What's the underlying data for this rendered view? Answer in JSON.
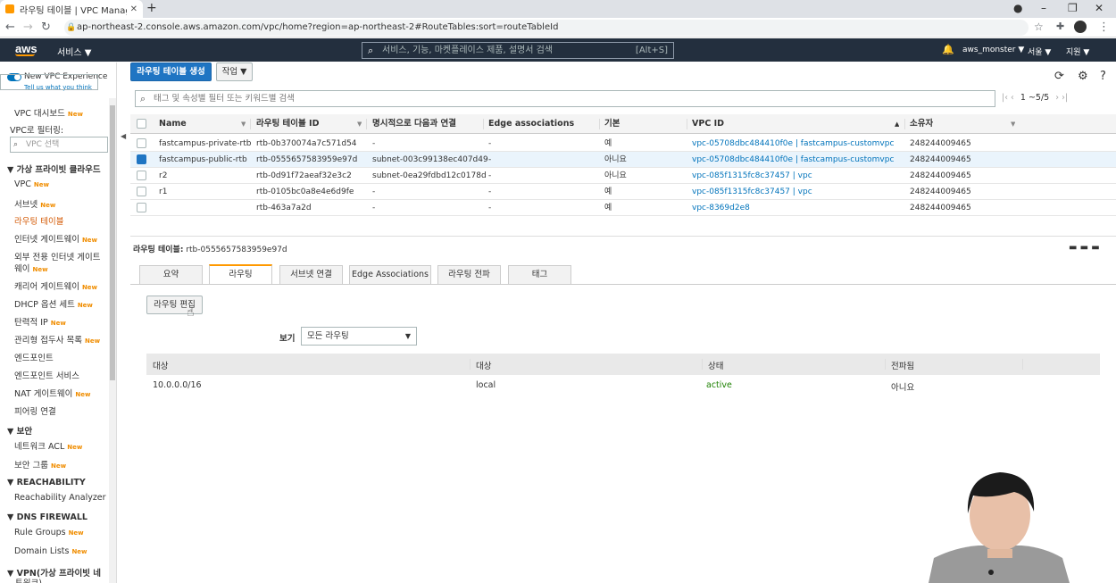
{
  "browser": {
    "tab_title": "라우팅 테이블 | VPC Manag",
    "url": "ap-northeast-2.console.aws.amazon.com/vpc/home?region=ap-northeast-2#RouteTables:sort=routeTableId"
  },
  "header": {
    "logo": "aws",
    "services": "서비스 ▼",
    "search_placeholder": "서비스, 기능, 마켓플레이스 제품, 설명서 검색",
    "search_shortcut": "[Alt+S]",
    "account": "aws_monster ▼",
    "region": "서울 ▼",
    "support": "지원 ▼"
  },
  "sidebar": {
    "new_experience": "New VPC Experience",
    "tell_us": "Tell us what you think",
    "dashboard": "VPC 대시보드",
    "filter_label": "VPC로 필터링:",
    "filter_placeholder": "VPC 선택",
    "section_vpc": "▼ 가상 프라이빗 클라우드",
    "items": [
      {
        "label": "VPC",
        "new": "New"
      },
      {
        "label": "서브넷",
        "new": "New"
      },
      {
        "label": "라우팅 테이블",
        "new": ""
      },
      {
        "label": "인터넷 게이트웨이",
        "new": "New"
      },
      {
        "label": "외부 전용 인터넷 게이트",
        "new": ""
      },
      {
        "label": "웨이",
        "new": "New"
      },
      {
        "label": "캐리어 게이트웨이",
        "new": "New"
      },
      {
        "label": "DHCP 옵션 세트",
        "new": "New"
      },
      {
        "label": "탄력적 IP",
        "new": "New"
      },
      {
        "label": "관리형 접두사 목록",
        "new": "New"
      },
      {
        "label": "엔드포인트",
        "new": ""
      },
      {
        "label": "엔드포인트 서비스",
        "new": ""
      },
      {
        "label": "NAT 게이트웨이",
        "new": "New"
      },
      {
        "label": "피어링 연결",
        "new": ""
      }
    ],
    "section_security": "▼ 보안",
    "security_items": [
      {
        "label": "네트워크 ACL",
        "new": "New"
      },
      {
        "label": "보안 그룹",
        "new": "New"
      }
    ],
    "section_reach": "▼ REACHABILITY",
    "reach_item": "Reachability Analyzer",
    "section_dns": "▼ DNS FIREWALL",
    "dns_items": [
      {
        "label": "Rule Groups",
        "new": "New"
      },
      {
        "label": "Domain Lists",
        "new": "New"
      }
    ],
    "section_vpn": "▼ VPN(가상 프라이빗 네",
    "section_vpn2": "트워크)",
    "new_badge": "New"
  },
  "toolbar": {
    "create": "라우팅 테이블 생성",
    "actions": "작업 ▼"
  },
  "filter": {
    "placeholder": "태그 및 속성별 필터 또는 키워드별 검색",
    "pager": "1 ~5/5"
  },
  "table": {
    "headers": [
      "Name",
      "라우팅 테이블 ID",
      "명시적으로 다음과 연결",
      "Edge associations",
      "기본",
      "VPC ID",
      "소유자"
    ],
    "rows": [
      {
        "name": "fastcampus-private-rtb",
        "id": "rtb-0b370074a7c571d54",
        "assoc": "-",
        "edge": "-",
        "main": "예",
        "vpc": "vpc-05708dbc484410f0e | fastcampus-customvpc",
        "owner": "248244009465"
      },
      {
        "name": "fastcampus-public-rtb",
        "id": "rtb-0555657583959e97d",
        "assoc": "subnet-003c99138ec407d49",
        "edge": "-",
        "main": "아니요",
        "vpc": "vpc-05708dbc484410f0e | fastcampus-customvpc",
        "owner": "248244009465"
      },
      {
        "name": "r2",
        "id": "rtb-0d91f72aeaf32e3c2",
        "assoc": "subnet-0ea29fdbd12c0178d",
        "edge": "-",
        "main": "아니요",
        "vpc": "vpc-085f1315fc8c37457 | vpc",
        "owner": "248244009465"
      },
      {
        "name": "r1",
        "id": "rtb-0105bc0a8e4e6d9fe",
        "assoc": "-",
        "edge": "-",
        "main": "예",
        "vpc": "vpc-085f1315fc8c37457 | vpc",
        "owner": "248244009465"
      },
      {
        "name": "",
        "id": "rtb-463a7a2d",
        "assoc": "-",
        "edge": "-",
        "main": "예",
        "vpc": "vpc-8369d2e8",
        "owner": "248244009465"
      }
    ]
  },
  "detail": {
    "label": "라우팅 테이블:",
    "id": "rtb-0555657583959e97d",
    "tabs": [
      "요약",
      "라우팅",
      "서브넷 연결",
      "Edge Associations",
      "라우팅 전파",
      "태그"
    ],
    "edit_button": "라우팅 편집",
    "view_label": "보기",
    "view_value": "모든 라우팅",
    "route_headers": [
      "대상",
      "대상",
      "상태",
      "전파됨"
    ],
    "routes": [
      {
        "destination": "10.0.0.0/16",
        "target": "local",
        "status": "active",
        "propagated": "아니요"
      }
    ]
  }
}
